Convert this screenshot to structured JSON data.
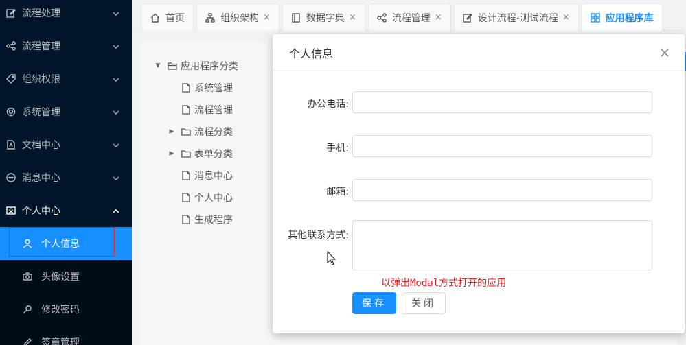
{
  "sidebar": {
    "items": [
      {
        "label": "流程处理",
        "icon": "edit-icon"
      },
      {
        "label": "流程管理",
        "icon": "share-icon"
      },
      {
        "label": "组织权限",
        "icon": "tag-icon"
      },
      {
        "label": "系统管理",
        "icon": "gear-icon"
      },
      {
        "label": "文档中心",
        "icon": "document-icon"
      },
      {
        "label": "消息中心",
        "icon": "message-icon"
      },
      {
        "label": "个人中心",
        "icon": "contact-card-icon"
      }
    ],
    "sub_items": [
      {
        "label": "个人信息",
        "icon": "user-icon"
      },
      {
        "label": "头像设置",
        "icon": "camera-icon"
      },
      {
        "label": "修改密码",
        "icon": "key-icon"
      },
      {
        "label": "签章管理",
        "icon": "pen-icon"
      }
    ]
  },
  "tabs": [
    {
      "label": "首页",
      "icon": "home-icon",
      "closable": false
    },
    {
      "label": "组织架构",
      "icon": "org-icon",
      "closable": true
    },
    {
      "label": "数据字典",
      "icon": "book-icon",
      "closable": true
    },
    {
      "label": "流程管理",
      "icon": "share-icon",
      "closable": true
    },
    {
      "label": "设计流程-测试流程",
      "icon": "edit-icon",
      "closable": true
    },
    {
      "label": "应用程序库",
      "icon": "grid-icon",
      "closable": false
    }
  ],
  "tab_close_glyph": "×",
  "tree": [
    {
      "label": "应用程序分类",
      "level": 0,
      "expanded": true
    },
    {
      "label": "系统管理",
      "level": 1,
      "type": "file"
    },
    {
      "label": "流程管理",
      "level": 1,
      "type": "file"
    },
    {
      "label": "流程分类",
      "level": 1,
      "type": "folder"
    },
    {
      "label": "表单分类",
      "level": 1,
      "type": "folder"
    },
    {
      "label": "消息中心",
      "level": 1,
      "type": "file"
    },
    {
      "label": "个人中心",
      "level": 1,
      "type": "file"
    },
    {
      "label": "生成程序",
      "level": 1,
      "type": "file"
    }
  ],
  "modal": {
    "title": "个人信息",
    "fields": {
      "office_phone": {
        "label": "办公电话:",
        "value": ""
      },
      "mobile": {
        "label": "手机:",
        "value": ""
      },
      "email": {
        "label": "邮箱:",
        "value": ""
      },
      "other_contact": {
        "label": "其他联系方式:",
        "value": ""
      }
    },
    "note": "以弹出Modal方式打开的应用",
    "save_label": "保存",
    "close_label": "关闭"
  },
  "colors": {
    "sidebar_bg": "#001529",
    "accent": "#1890ff",
    "annotation_red": "#e02020"
  }
}
